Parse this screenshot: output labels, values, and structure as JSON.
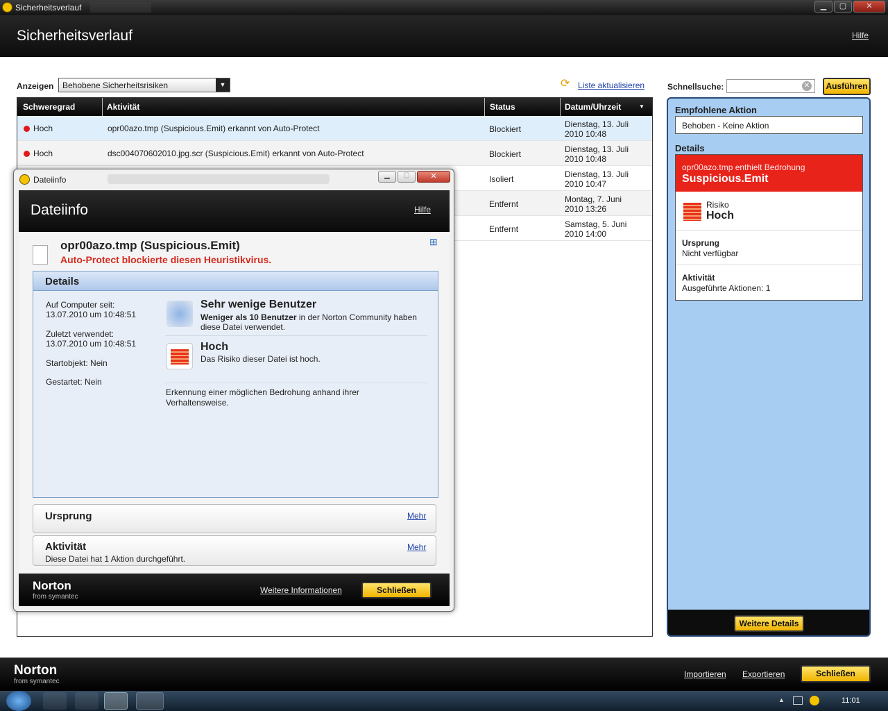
{
  "window": {
    "title": "Sicherheitsverlauf",
    "header": "Sicherheitsverlauf",
    "help": "Hilfe",
    "min": "▁",
    "max": "▢",
    "close": "✕"
  },
  "toolbar": {
    "show_label": "Anzeigen",
    "view_value": "Behobene Sicherheitsrisiken",
    "refresh": "Liste aktualisieren"
  },
  "table": {
    "headers": [
      "Schweregrad",
      "Aktivität",
      "Status",
      "Datum/Uhrzeit"
    ],
    "rows": [
      {
        "severity": "Hoch",
        "activity": "opr00azo.tmp (Suspicious.Emit) erkannt von Auto-Protect",
        "status": "Blockiert",
        "date1": "Dienstag, 13. Juli",
        "date2": "2010 10:48"
      },
      {
        "severity": "Hoch",
        "activity": "dsc004070602010.jpg.scr (Suspicious.Emit) erkannt von Auto-Protect",
        "status": "Blockiert",
        "date1": "Dienstag, 13. Juli",
        "date2": "2010 10:48"
      },
      {
        "severity": "",
        "activity": "",
        "status": "Isoliert",
        "date1": "Dienstag, 13. Juli",
        "date2": "2010 10:47"
      },
      {
        "severity": "",
        "activity": "",
        "status": "Entfernt",
        "date1": "Montag, 7. Juni",
        "date2": "2010 13:26"
      },
      {
        "severity": "",
        "activity": "",
        "status": "Entfernt",
        "date1": "Samstag, 5. Juni",
        "date2": "2010 14:00"
      }
    ]
  },
  "right": {
    "search_label": "Schnellsuche:",
    "search_value": "",
    "run_button": "Ausführen",
    "rec_title": "Empfohlene Aktion",
    "rec_value": "Behoben - Keine Aktion",
    "details_title": "Details",
    "threat_line": "opr00azo.tmp enthielt Bedrohung",
    "threat_name": "Suspicious.Emit",
    "risk_label": "Risiko",
    "risk_value": "Hoch",
    "origin_label": "Ursprung",
    "origin_value": "Nicht verfügbar",
    "activity_label": "Aktivität",
    "activity_value": "Ausgeführte Aktionen: 1",
    "more_details": "Weitere Details"
  },
  "dialog": {
    "title": "Dateiinfo",
    "header": "Dateiinfo",
    "help": "Hilfe",
    "filename": "opr00azo.tmp (Suspicious.Emit)",
    "subtitle": "Auto-Protect blockierte diesen Heuristikvirus.",
    "details": "Details",
    "on_pc_label": "Auf Computer seit:",
    "on_pc_value": "13.07.2010 um 10:48:51",
    "last_used_label": "Zuletzt verwendet:",
    "last_used_value": "13.07.2010 um 10:48:51",
    "startup": "Startobjekt: Nein",
    "started": "Gestartet: Nein",
    "users_title": "Sehr wenige Benutzer",
    "users_bold": "Weniger als 10 Benutzer",
    "users_rest": " in der Norton Community haben",
    "users_line2": "diese Datei verwendet.",
    "risk_title": "Hoch",
    "risk_desc": "Das Risiko dieser Datei ist hoch.",
    "detection": "Erkennung einer möglichen Bedrohung anhand ihrer Verhaltensweise.",
    "origin": "Ursprung",
    "more1": "Mehr",
    "activity": "Aktivität",
    "activity_desc": "Diese Datei hat 1 Aktion durchgeführt.",
    "more2": "Mehr",
    "more_info": "Weitere Informationen",
    "close": "Schließen",
    "brand": "Norton",
    "brand_sub": "from symantec"
  },
  "footer": {
    "brand": "Norton",
    "brand_sub": "from symantec",
    "import": "Importieren",
    "export": "Exportieren",
    "close": "Schließen"
  },
  "taskbar": {
    "time": "11:01"
  },
  "colors": {
    "danger": "#e01a1a",
    "accent_yellow": "#f5c400",
    "panel_blue": "#a7cdf2"
  }
}
